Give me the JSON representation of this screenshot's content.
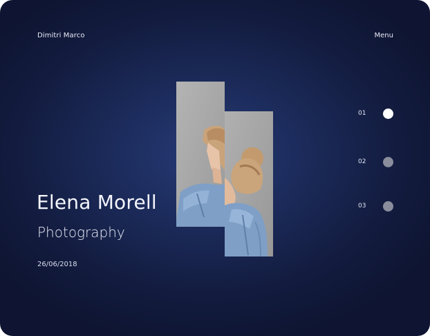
{
  "header": {
    "brand": "Dimitri Marco",
    "menu_label": "Menu"
  },
  "hero": {
    "title": "Elena Morell",
    "subtitle": "Photography",
    "date": "26/06/2018"
  },
  "pager": {
    "items": [
      {
        "label": "01",
        "active": true
      },
      {
        "label": "02",
        "active": false
      },
      {
        "label": "03",
        "active": false
      }
    ]
  },
  "colors": {
    "background": "#1b2a59",
    "text": "#f4f6fc",
    "dot_active": "#ffffff",
    "dot_inactive": "#8a8d9b",
    "photo_backdrop": "#adadad",
    "denim": "#7f9fc6"
  }
}
